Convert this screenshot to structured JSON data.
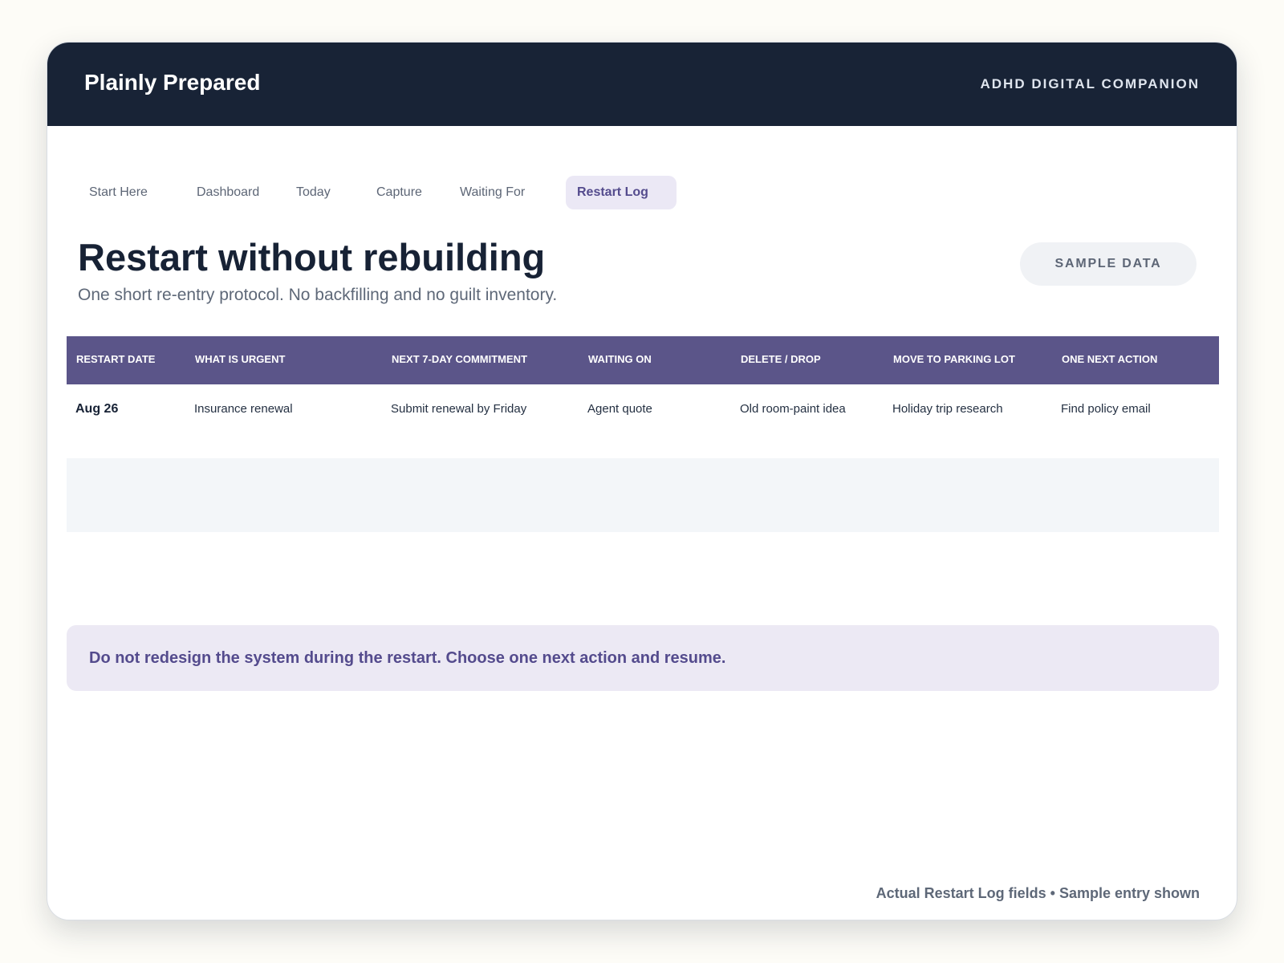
{
  "header": {
    "brand": "Plainly Prepared",
    "tagline": "ADHD DIGITAL COMPANION"
  },
  "tabs": [
    {
      "label": "Start Here",
      "active": false
    },
    {
      "label": "Dashboard",
      "active": false
    },
    {
      "label": "Today",
      "active": false
    },
    {
      "label": "Capture",
      "active": false
    },
    {
      "label": "Waiting For",
      "active": false
    },
    {
      "label": "Restart Log",
      "active": true
    }
  ],
  "page": {
    "title": "Restart without rebuilding",
    "subtitle": "One short re-entry protocol. No backfilling and no guilt inventory.",
    "badge": "SAMPLE DATA"
  },
  "table": {
    "columns": [
      "RESTART DATE",
      "WHAT IS URGENT",
      "NEXT 7-DAY COMMITMENT",
      "WAITING ON",
      "DELETE / DROP",
      "MOVE TO PARKING LOT",
      "ONE NEXT ACTION"
    ],
    "rows": [
      [
        "Aug 26",
        "Insurance renewal",
        "Submit renewal by Friday",
        "Agent quote",
        "Old room-paint idea",
        "Holiday trip research",
        "Find policy email"
      ]
    ]
  },
  "note": "Do not redesign the system during the restart. Choose one next action and resume.",
  "footnote": "Actual Restart Log fields • Sample entry shown",
  "colors": {
    "header_bg": "#182336",
    "accent": "#5b5589",
    "accent_text": "#544b8d",
    "note_bg": "#ece9f4",
    "page_bg": "#fdfcf7"
  }
}
